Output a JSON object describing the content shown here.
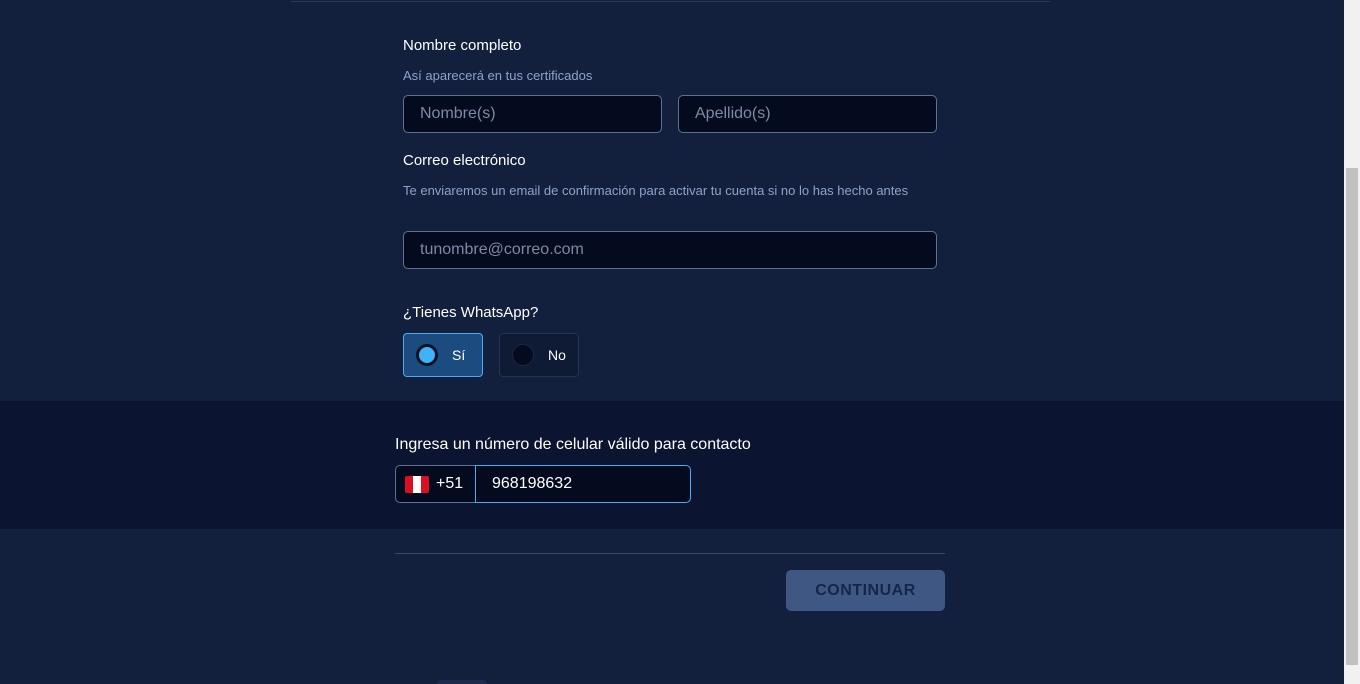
{
  "form": {
    "full_name": {
      "label": "Nombre completo",
      "hint": "Así aparecerá en tus certificados",
      "first_name_placeholder": "Nombre(s)",
      "last_name_placeholder": "Apellido(s)"
    },
    "email": {
      "label": "Correo electrónico",
      "hint": "Te enviaremos un email de confirmación para activar tu cuenta si no lo has hecho antes",
      "placeholder": "tunombre@correo.com"
    },
    "whatsapp": {
      "label": "¿Tienes WhatsApp?",
      "options": [
        {
          "label": "Sí",
          "selected": true
        },
        {
          "label": "No",
          "selected": false
        }
      ]
    }
  },
  "phone": {
    "label": "Ingresa un número de celular válido para contacto",
    "country_flag": "peru-flag-icon",
    "dial_code": "+51",
    "value": "968198632"
  },
  "actions": {
    "continue_label": "CONTINUAR"
  },
  "colors": {
    "background": "#121f3d",
    "phone_band": "#0b1430",
    "accent": "#41b2f5",
    "button": "#3f5883"
  }
}
